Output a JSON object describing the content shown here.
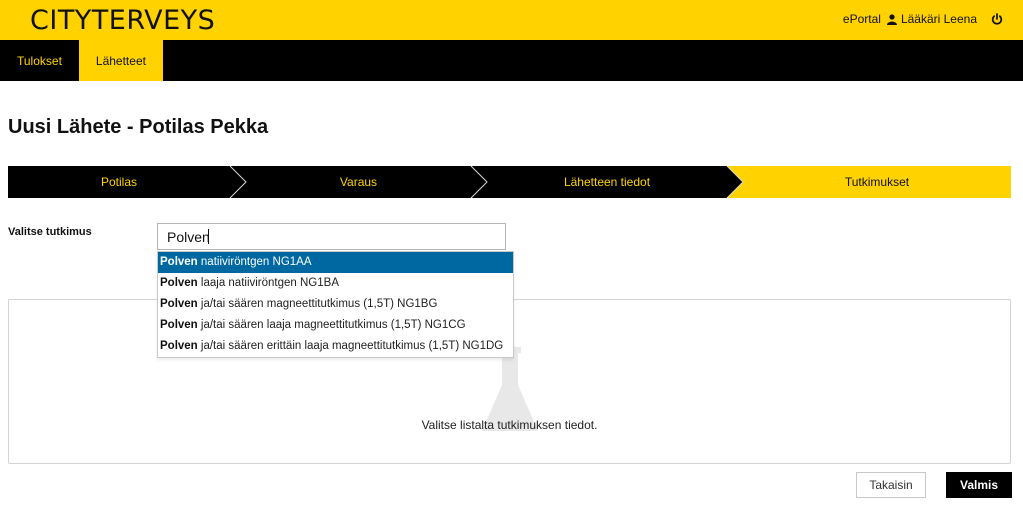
{
  "header": {
    "logo": "CITYTERVEYS",
    "portal_link": "ePortal",
    "user_name": "Lääkäri Leena",
    "icons": [
      "user-icon",
      "power-icon"
    ]
  },
  "nav": {
    "tabs": [
      {
        "label": "Tulokset",
        "active": false
      },
      {
        "label": "Lähetteet",
        "active": true
      }
    ]
  },
  "page": {
    "title": "Uusi Lähete - Potilas Pekka"
  },
  "steps": [
    {
      "label": "Potilas",
      "active": false
    },
    {
      "label": "Varaus",
      "active": false
    },
    {
      "label": "Lähetteen tiedot",
      "active": false
    },
    {
      "label": "Tutkimukset",
      "active": true
    }
  ],
  "form": {
    "label": "Valitse tutkimus",
    "search_value": "Polven"
  },
  "autocomplete": {
    "match": "Polven",
    "items": [
      {
        "bold": "Polven",
        "rest": " natiiviröntgen NG1AA",
        "selected": true
      },
      {
        "bold": "Polven",
        "rest": " laaja natiiviröntgen NG1BA",
        "selected": false
      },
      {
        "bold": "Polven",
        "rest": " ja/tai säären magneettitutkimus (1,5T) NG1BG",
        "selected": false
      },
      {
        "bold": "Polven",
        "rest": " ja/tai säären laaja magneettitutkimus (1,5T) NG1CG",
        "selected": false
      },
      {
        "bold": "Polven",
        "rest": " ja/tai säären erittäin laaja magneettitutkimus (1,5T) NG1DG",
        "selected": false
      }
    ]
  },
  "panel": {
    "icon": "flask-icon",
    "message": "Valitse listalta tutkimuksen tiedot."
  },
  "buttons": {
    "back": "Takaisin",
    "done": "Valmis"
  },
  "colors": {
    "brand_yellow": "#ffd200",
    "nav_black": "#000000",
    "selection_blue": "#0068a1",
    "step_divider": "#d9d9d9"
  }
}
